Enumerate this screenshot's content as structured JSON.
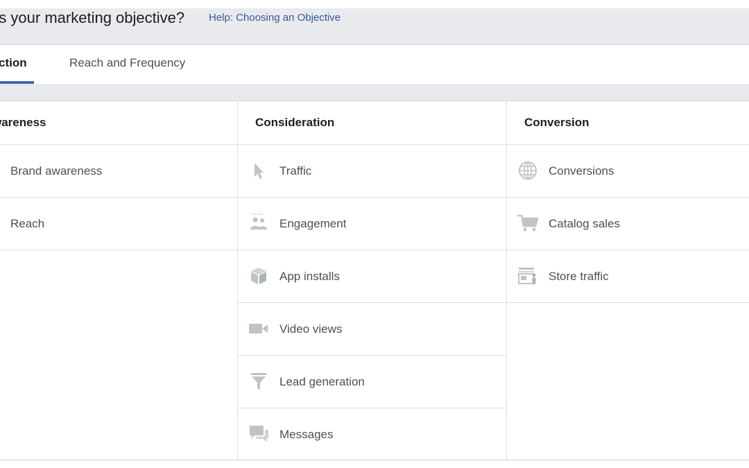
{
  "header": {
    "title": "t's your marketing objective?",
    "help_link": "Help: Choosing an Objective"
  },
  "tabs": [
    {
      "label": "ction",
      "active": true
    },
    {
      "label": "Reach and Frequency",
      "active": false
    }
  ],
  "columns": [
    {
      "heading": "wareness",
      "items": [
        {
          "label": "Brand awareness"
        },
        {
          "label": "Reach"
        }
      ]
    },
    {
      "heading": "Consideration",
      "items": [
        {
          "label": "Traffic",
          "icon": "cursor-icon"
        },
        {
          "label": "Engagement",
          "icon": "people-icon"
        },
        {
          "label": "App installs",
          "icon": "box-icon"
        },
        {
          "label": "Video views",
          "icon": "video-camera-icon"
        },
        {
          "label": "Lead generation",
          "icon": "funnel-icon"
        },
        {
          "label": "Messages",
          "icon": "chat-bubbles-icon"
        }
      ]
    },
    {
      "heading": "Conversion",
      "items": [
        {
          "label": "Conversions",
          "icon": "globe-icon"
        },
        {
          "label": "Catalog sales",
          "icon": "shopping-cart-icon"
        },
        {
          "label": "Store traffic",
          "icon": "storefront-icon"
        }
      ]
    }
  ],
  "colors": {
    "header_bg": "#e9eaed",
    "accent": "#4267b2",
    "link": "#385898",
    "icon": "#bec3c9",
    "text": "#4b4f56"
  }
}
